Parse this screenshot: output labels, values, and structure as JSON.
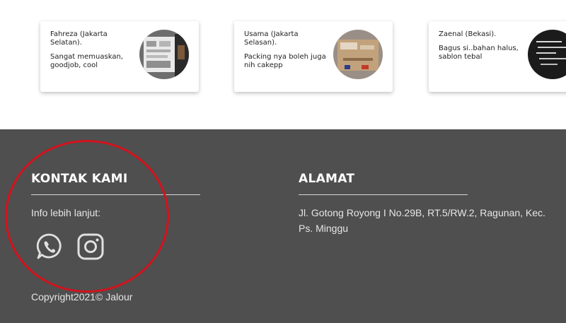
{
  "testimonials": [
    {
      "name": "Fahreza (Jakarta Selatan).",
      "review": "Sangat memuaskan, goodjob, cool"
    },
    {
      "name": "Usama (Jakarta Selasan).",
      "review": "Packing nya boleh juga nih cakepp"
    },
    {
      "name": "Zaenal (Bekasi).",
      "review": "Bagus si..bahan halus, sablon tebal"
    }
  ],
  "footer": {
    "contact_heading": "KONTAK KAMI",
    "contact_info": "Info lebih lanjut:",
    "address_heading": "ALAMAT",
    "address_text": "Jl. Gotong Royong I No.29B, RT.5/RW.2, Ragunan, Kec. Ps. Minggu",
    "copyright": "Copyright2021© Jalour",
    "social_icons": [
      "whatsapp-icon",
      "instagram-icon"
    ]
  },
  "colors": {
    "footer_bg": "#4f4f4f",
    "annotation_circle": "#d3121c"
  }
}
